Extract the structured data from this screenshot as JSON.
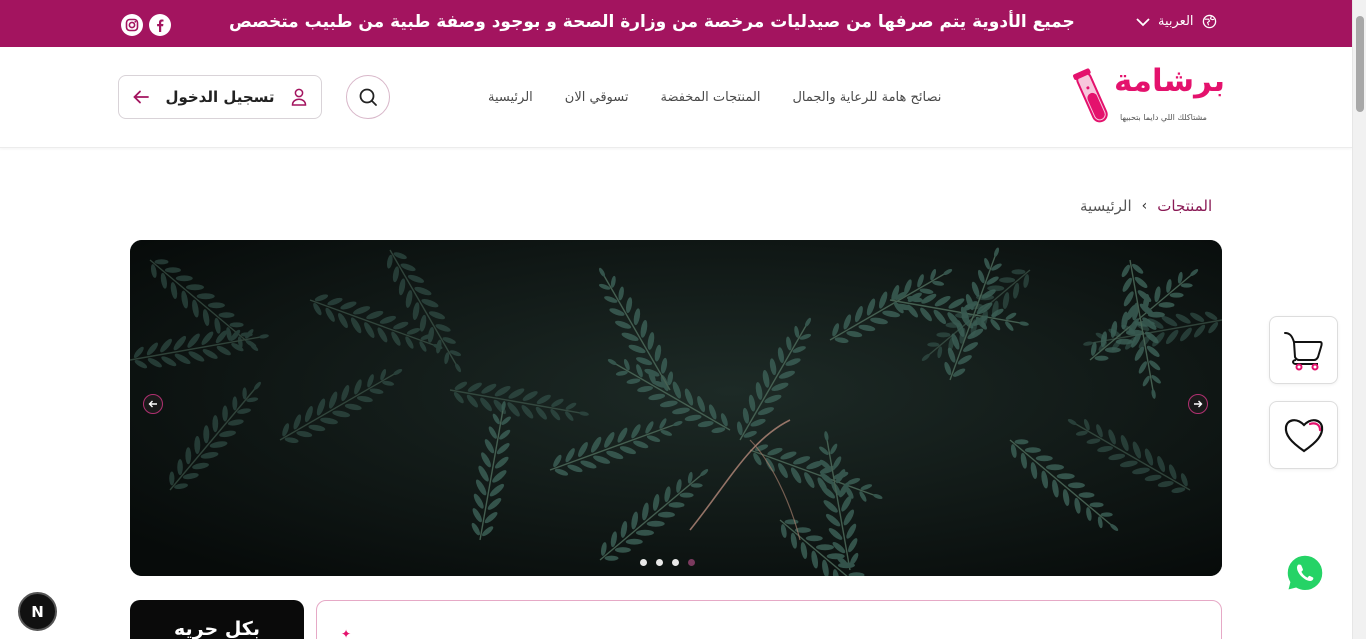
{
  "topbar": {
    "promo_text": "جميع الأدوية يتم صرفها من صيدليات مرخصة من وزارة الصحة و بوجود وصفة طبية من طبيب متخصص",
    "language": "العربية",
    "social": [
      "instagram-icon",
      "facebook-icon"
    ],
    "background_color": "#a3145f"
  },
  "header": {
    "logo_text": "برشامة",
    "logo_tagline": "مشتاكلك اللي دايما بتحبيها",
    "nav": [
      "الرئيسية",
      "تسوقي الان",
      "المنتجات المخفضة",
      "نصائح هامة للرعاية والجمال"
    ],
    "login_label": "تسجيل الدخول",
    "accent_color": "#e4126d"
  },
  "breadcrumb": {
    "home": "الرئيسية",
    "separator": "›",
    "current": "المنتجات"
  },
  "hero": {
    "slide_count": 4,
    "active_index": 3
  },
  "bottom": {
    "filter_title": "بكل حريه"
  },
  "next_badge": "N"
}
